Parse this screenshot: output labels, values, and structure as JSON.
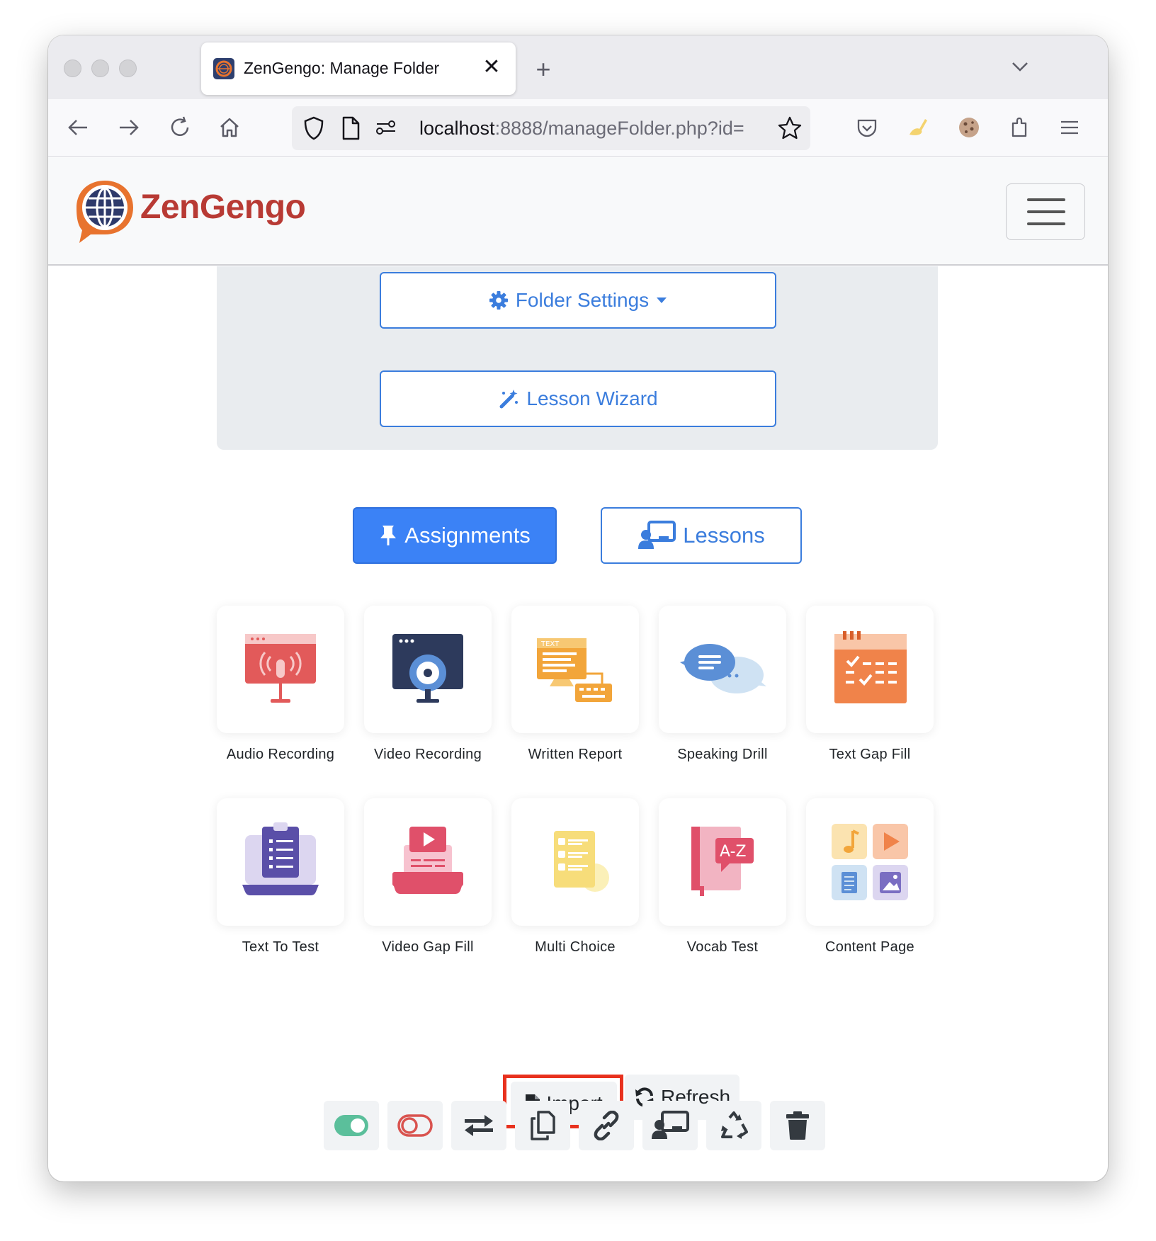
{
  "browser": {
    "tab_title": "ZenGengo: Manage Folder",
    "url_host": "localhost",
    "url_rest": ":8888/manageFolder.php?id="
  },
  "app": {
    "brand": "ZenGengo",
    "brand_color": "#b83a34"
  },
  "panel": {
    "folder_settings_label": "Folder Settings",
    "lesson_wizard_label": "Lesson Wizard"
  },
  "view_tabs": {
    "assignments_label": "Assignments",
    "lessons_label": "Lessons",
    "active": "Assignments"
  },
  "activities": [
    {
      "label": "Audio Recording",
      "icon": "audio-recording-icon"
    },
    {
      "label": "Video Recording",
      "icon": "video-recording-icon"
    },
    {
      "label": "Written Report",
      "icon": "written-report-icon"
    },
    {
      "label": "Speaking Drill",
      "icon": "speaking-drill-icon"
    },
    {
      "label": "Text Gap Fill",
      "icon": "text-gap-fill-icon"
    },
    {
      "label": "Text To Test",
      "icon": "text-to-test-icon"
    },
    {
      "label": "Video Gap Fill",
      "icon": "video-gap-fill-icon"
    },
    {
      "label": "Multi Choice",
      "icon": "multi-choice-icon"
    },
    {
      "label": "Vocab Test",
      "icon": "vocab-test-icon"
    },
    {
      "label": "Content Page",
      "icon": "content-page-icon"
    }
  ],
  "vocab_badge": "A-Z",
  "report_badge": "TEXT",
  "actions": {
    "import_label": "Import",
    "refresh_label": "Refresh",
    "icons": [
      "toggle-on-icon",
      "toggle-off-icon",
      "exchange-icon",
      "copy-icon",
      "link-icon",
      "presentation-icon",
      "recycle-icon",
      "trash-icon"
    ]
  },
  "colors": {
    "primary": "#3b82f6",
    "highlight": "#e8311e",
    "toggle_on": "#5bbf9b",
    "toggle_off": "#d9534f"
  }
}
